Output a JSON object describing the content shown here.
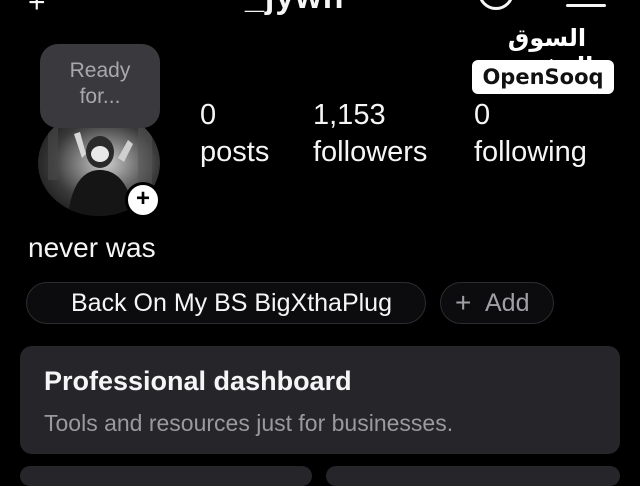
{
  "header": {
    "username": "_jywn",
    "back_icon": "plus-icon",
    "threads_icon": "threads-icon",
    "menu_icon": "menu-icon"
  },
  "watermark": {
    "arabic": "السوق المفتوح",
    "brand": "OpenSooq"
  },
  "profile": {
    "note": "Ready for...",
    "note_line1": "Ready",
    "note_line2": "for...",
    "add_story": "+",
    "stats": [
      {
        "value": "0",
        "label": "posts"
      },
      {
        "value": "1,153",
        "label": "followers"
      },
      {
        "value": "0",
        "label": "following"
      }
    ],
    "bio": "never was"
  },
  "chips": {
    "music": "Back On My BS BigXthaPlug",
    "add": "Add"
  },
  "dashboard": {
    "title": "Professional dashboard",
    "subtitle": "Tools and resources just for businesses."
  },
  "colors": {
    "background": "#000000",
    "card": "#26262a",
    "text": "#f5f5f5",
    "muted": "#9a9a9e"
  }
}
